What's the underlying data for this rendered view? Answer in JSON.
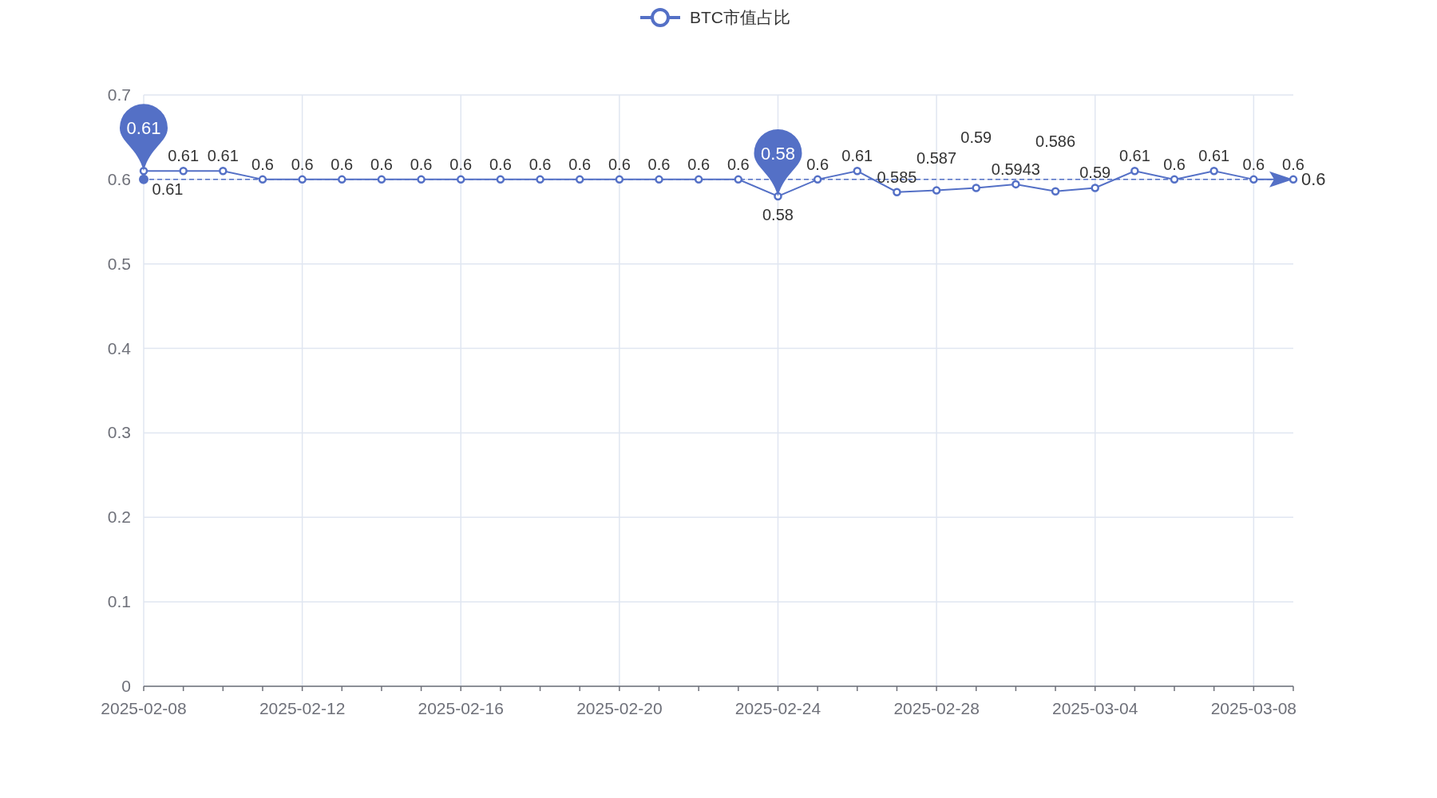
{
  "chart": {
    "chart_data": {
      "type": "line",
      "x": [
        "2025-02-08",
        "2025-02-09",
        "2025-02-10",
        "2025-02-11",
        "2025-02-12",
        "2025-02-13",
        "2025-02-14",
        "2025-02-15",
        "2025-02-16",
        "2025-02-17",
        "2025-02-18",
        "2025-02-19",
        "2025-02-20",
        "2025-02-21",
        "2025-02-22",
        "2025-02-23",
        "2025-02-24",
        "2025-02-25",
        "2025-02-26",
        "2025-02-27",
        "2025-02-28",
        "2025-03-01",
        "2025-03-02",
        "2025-03-03",
        "2025-03-04",
        "2025-03-05",
        "2025-03-06",
        "2025-03-07",
        "2025-03-08",
        "2025-03-09"
      ],
      "series": [
        {
          "name": "BTC市值占比",
          "color": "#5470c6",
          "marker": "circle",
          "values": [
            0.61,
            0.61,
            0.61,
            0.6,
            0.6,
            0.6,
            0.6,
            0.6,
            0.6,
            0.6,
            0.6,
            0.6,
            0.6,
            0.6,
            0.6,
            0.6,
            0.58,
            0.6,
            0.61,
            0.585,
            0.587,
            0.59,
            0.5943,
            0.586,
            0.59,
            0.61,
            0.6,
            0.61,
            0.6,
            0.6
          ]
        }
      ],
      "ylim": [
        0,
        0.7
      ],
      "yticks": [
        0,
        0.1,
        0.2,
        0.3,
        0.4,
        0.5,
        0.6,
        0.7
      ],
      "xticks": [
        {
          "value": "2025-02-08",
          "label": "2025-02-08"
        },
        {
          "value": "2025-02-12",
          "label": "2025-02-12"
        },
        {
          "value": "2025-02-16",
          "label": "2025-02-16"
        },
        {
          "value": "2025-02-20",
          "label": "2025-02-20"
        },
        {
          "value": "2025-02-24",
          "label": "2025-02-24"
        },
        {
          "value": "2025-02-28",
          "label": "2025-02-28"
        },
        {
          "value": "2025-03-04",
          "label": "2025-03-04"
        },
        {
          "value": "2025-03-08",
          "label": "2025-03-08"
        }
      ],
      "grid": true,
      "data_labels": true,
      "ref_lines": [
        {
          "axis": "y",
          "value": 0.6,
          "label": "0.6"
        }
      ],
      "xlim": [
        "2025-02-08",
        "2025-03-09"
      ],
      "annotations": [
        {
          "x": "2025-02-08",
          "y": 0.61,
          "text": "0.61"
        },
        {
          "x": "2025-02-24",
          "y": 0.58,
          "text": "0.58"
        }
      ]
    }
  }
}
